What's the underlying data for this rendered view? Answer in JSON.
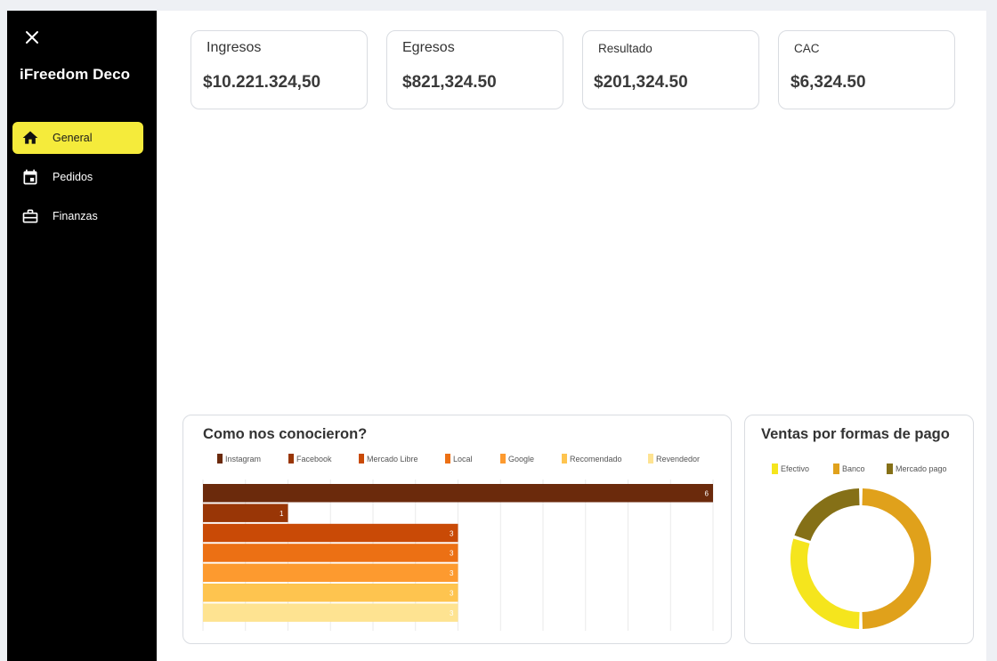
{
  "sidebar": {
    "brand": "iFreedom Deco",
    "items": [
      {
        "label": "General",
        "icon": "home-icon",
        "active": true
      },
      {
        "label": "Pedidos",
        "icon": "calendar-icon",
        "active": false
      },
      {
        "label": "Finanzas",
        "icon": "briefcase-icon",
        "active": false
      }
    ]
  },
  "kpis": [
    {
      "title": "Ingresos",
      "value": "$10.221.324,50"
    },
    {
      "title": "Egresos",
      "value": "$821,324.50"
    },
    {
      "title": "Resultado",
      "value": "$201,324.50"
    },
    {
      "title": "CAC",
      "value": "$6,324.50"
    }
  ],
  "colors": {
    "accent": "#f5eb3b",
    "sidebar": "#000000"
  },
  "chart_data": [
    {
      "type": "bar",
      "orientation": "horizontal",
      "title": "Como nos conocieron?",
      "legend_position": "top",
      "grid": true,
      "xlim": [
        0,
        6
      ],
      "series": [
        {
          "name": "Instagram",
          "value": 6,
          "color": "#6b2a0c"
        },
        {
          "name": "Facebook",
          "value": 1,
          "color": "#993606"
        },
        {
          "name": "Mercado Libre",
          "value": 3,
          "color": "#c94a06"
        },
        {
          "name": "Local",
          "value": 3,
          "color": "#ec7014"
        },
        {
          "name": "Google",
          "value": 3,
          "color": "#fd9a2f"
        },
        {
          "name": "Recomendado",
          "value": 3,
          "color": "#fec44f"
        },
        {
          "name": "Revendedor",
          "value": 3,
          "color": "#fee391"
        }
      ]
    },
    {
      "type": "pie",
      "donut": true,
      "title": "Ventas por formas de pago",
      "legend_position": "top",
      "slices": [
        {
          "name": "Efectivo",
          "value": 30,
          "color": "#f5e51d"
        },
        {
          "name": "Banco",
          "value": 50,
          "color": "#e0a11b"
        },
        {
          "name": "Mercado pago",
          "value": 20,
          "color": "#857017"
        }
      ]
    }
  ]
}
